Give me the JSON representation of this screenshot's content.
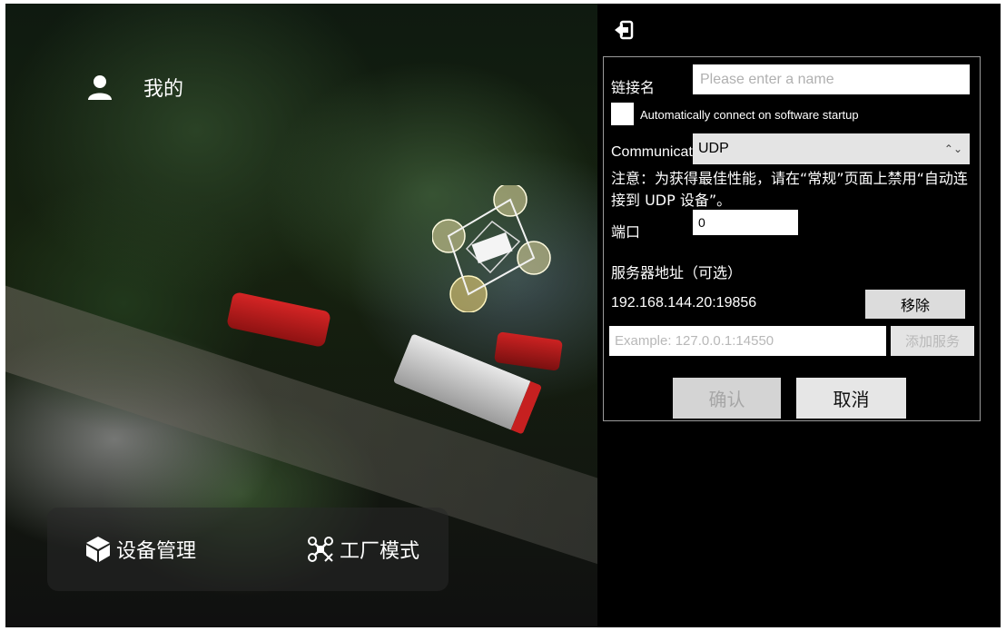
{
  "app": {
    "user_label": "我的",
    "nav": {
      "device_management": "设备管理",
      "factory_mode": "工厂模式"
    }
  },
  "dialog": {
    "name_label": "链接名",
    "name_placeholder": "Please enter a name",
    "name_value": "",
    "auto_connect_label": "Automatically connect on software startup",
    "auto_connect_checked": false,
    "comm_type_label": "Communication Type",
    "comm_type_value": "UDP",
    "note": "注意：为获得最佳性能，请在“常规”页面上禁用“自动连接到 UDP 设备”。",
    "port_label": "端口",
    "port_value": "0",
    "server_label": "服务器地址（可选）",
    "servers": [
      "192.168.144.20:19856"
    ],
    "remove_button": "移除",
    "server_placeholder": "Example: 127.0.0.1:14550",
    "add_server_button": "添加服务",
    "confirm_button": "确认",
    "cancel_button": "取消"
  },
  "icons": {
    "back": "back-arrow-icon",
    "user": "user-icon",
    "device": "cube-icon",
    "factory": "drone-tools-icon"
  }
}
